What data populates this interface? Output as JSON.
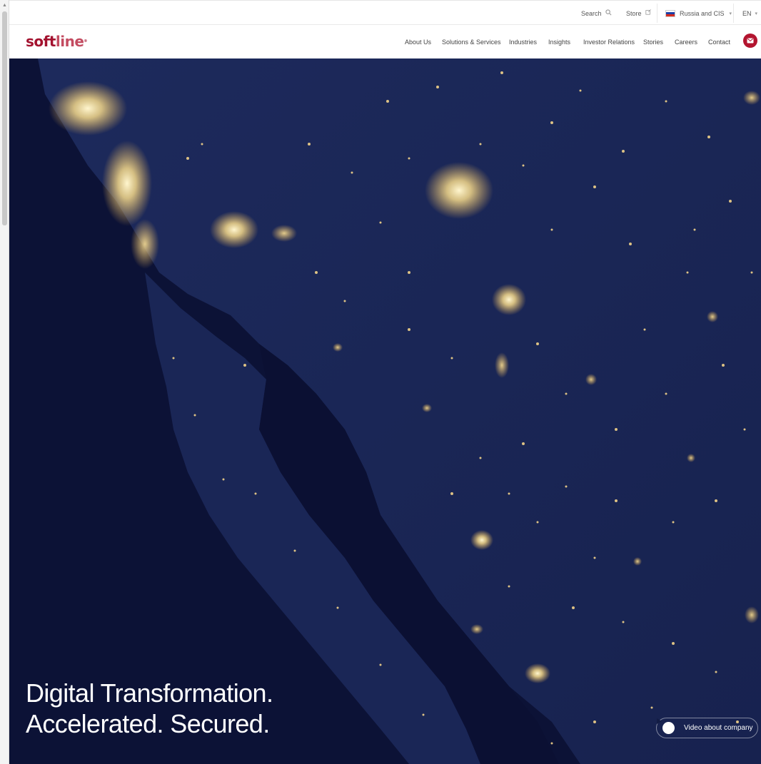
{
  "topbar": {
    "search_label": "Search",
    "search_icon": "search-icon",
    "store_label": "Store",
    "store_icon": "external-link-icon",
    "region_label": "Russia and CIS",
    "region_flag": "russia-flag-icon",
    "language_label": "EN"
  },
  "logo": {
    "part1": "soft",
    "part2": "line",
    "mark": "®"
  },
  "nav": {
    "items": [
      "About Us",
      "Solutions & Services",
      "Industries",
      "Insights",
      "Investor Relations",
      "Stories",
      "Careers",
      "Contact"
    ],
    "mail_icon": "mail-icon"
  },
  "hero": {
    "headline_line1": "Digital Transformation.",
    "headline_line2": "Accelerated. Secured.",
    "video_label": "Video about company",
    "background": "night-satellite-map"
  },
  "colors": {
    "brand_red": "#a3122f",
    "hero_bg": "#121c44",
    "city_light": "#f5d98a"
  }
}
